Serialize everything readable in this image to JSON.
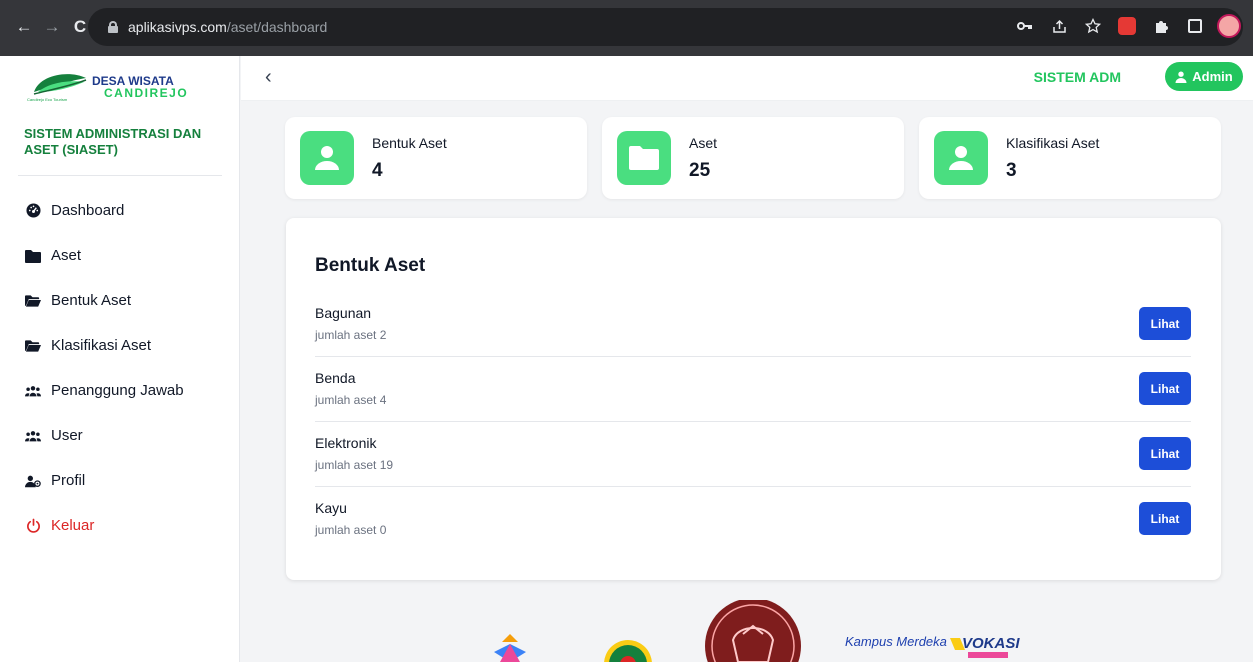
{
  "browser": {
    "url_domain": "aplikasivps.com",
    "url_path": "/aset/dashboard",
    "back_icon": "←",
    "forward_icon": "→",
    "reload_icon": "C"
  },
  "sidebar": {
    "logo_line1": "DESA WISATA",
    "logo_line2": "CANDIREJO",
    "logo_tagline": "Candirejo Eco Tourism",
    "system_title": "SISTEM ADMINISTRASI DAN ASET (SIASET)",
    "menu": [
      {
        "label": "Dashboard",
        "icon": "dashboard-icon"
      },
      {
        "label": "Aset",
        "icon": "folder-icon"
      },
      {
        "label": "Bentuk Aset",
        "icon": "folder-open-icon"
      },
      {
        "label": "Klasifikasi Aset",
        "icon": "folder-open-icon"
      },
      {
        "label": "Penanggung Jawab",
        "icon": "users-icon"
      },
      {
        "label": "User",
        "icon": "users-icon"
      },
      {
        "label": "Profil",
        "icon": "user-cog-icon"
      },
      {
        "label": "Keluar",
        "icon": "power-icon"
      }
    ]
  },
  "topbar": {
    "back_icon": "‹",
    "system_label": "SISTEM ADM",
    "admin_label": "Admin"
  },
  "stats": [
    {
      "label": "Bentuk Aset",
      "value": "4",
      "icon": "user-icon"
    },
    {
      "label": "Aset",
      "value": "25",
      "icon": "folder-icon"
    },
    {
      "label": "Klasifikasi Aset",
      "value": "3",
      "icon": "user-icon"
    }
  ],
  "panel": {
    "title": "Bentuk Aset",
    "items": [
      {
        "name": "Bagunan",
        "count": "jumlah aset 2",
        "button": "Lihat"
      },
      {
        "name": "Benda",
        "count": "jumlah aset 4",
        "button": "Lihat"
      },
      {
        "name": "Elektronik",
        "count": "jumlah aset 19",
        "button": "Lihat"
      },
      {
        "name": "Kayu",
        "count": "jumlah aset 0",
        "button": "Lihat"
      }
    ]
  },
  "footer": {
    "kampus_merdeka": "Kampus Merdeka",
    "vokasi": "VOKASI"
  },
  "colors": {
    "accent_green": "#22c55e",
    "button_blue": "#1d4ed8",
    "logout_red": "#dc2626"
  }
}
